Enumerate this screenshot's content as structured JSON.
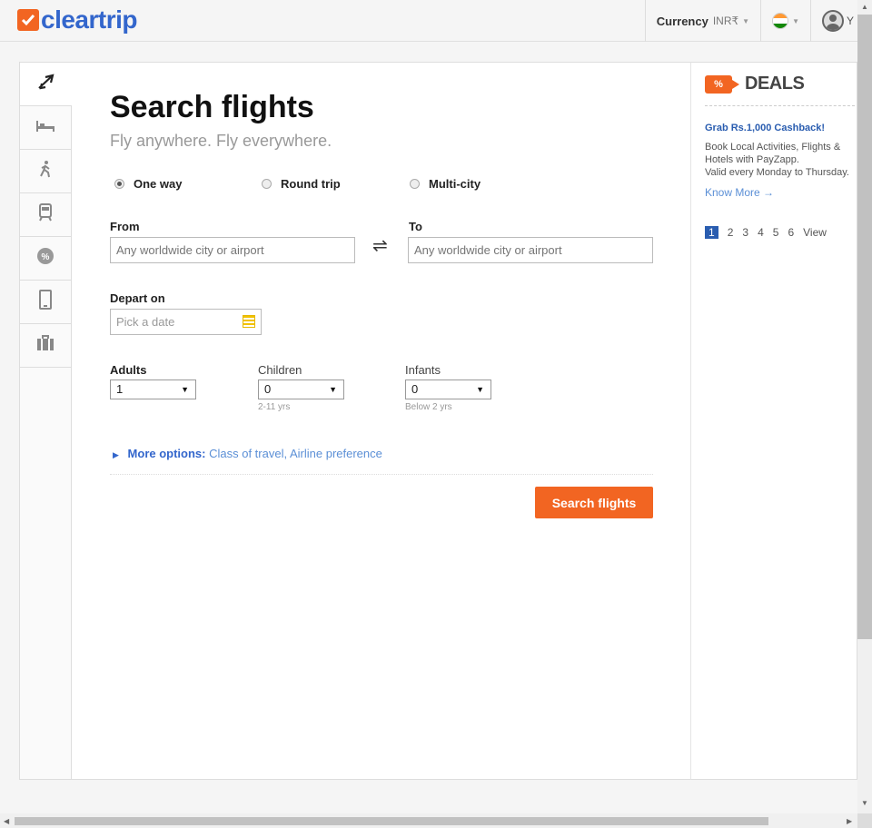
{
  "header": {
    "logo_text": "cleartrip",
    "currency_label": "Currency",
    "currency_value": "INR₹",
    "user_initial": "Y"
  },
  "sidebar": {
    "items": [
      "plane-icon",
      "hotel-icon",
      "activities-icon",
      "train-icon",
      "deals-icon",
      "mobile-icon",
      "briefcase-icon"
    ]
  },
  "search": {
    "title": "Search flights",
    "subtitle": "Fly anywhere. Fly everywhere.",
    "trip_types": [
      "One way",
      "Round trip",
      "Multi-city"
    ],
    "selected_trip": "One way",
    "from_label": "From",
    "from_placeholder": "Any worldwide city or airport",
    "to_label": "To",
    "to_placeholder": "Any worldwide city or airport",
    "swap_symbol": "⇌",
    "depart_label": "Depart on",
    "depart_placeholder": "Pick a date",
    "adults_label": "Adults",
    "adults_value": "1",
    "children_label": "Children",
    "children_value": "0",
    "children_hint": "2-11 yrs",
    "infants_label": "Infants",
    "infants_value": "0",
    "infants_hint": "Below 2 yrs",
    "more_options_label": "More options:",
    "more_options_text": "Class of travel, Airline preference",
    "submit_label": "Search flights"
  },
  "deals": {
    "tag_symbol": "%",
    "title": "DEALS",
    "heading": "Grab Rs.1,000 Cashback!",
    "body_line1": "Book Local Activities, Flights &",
    "body_line2": "Hotels with PayZapp.",
    "body_line3": "Valid every Monday to Thursday.",
    "link": "Know More →",
    "pages": [
      "1",
      "2",
      "3",
      "4",
      "5",
      "6"
    ],
    "current_page": "1",
    "view_label": "View"
  },
  "colors": {
    "brand_orange": "#f26522",
    "brand_blue": "#3366cc"
  }
}
